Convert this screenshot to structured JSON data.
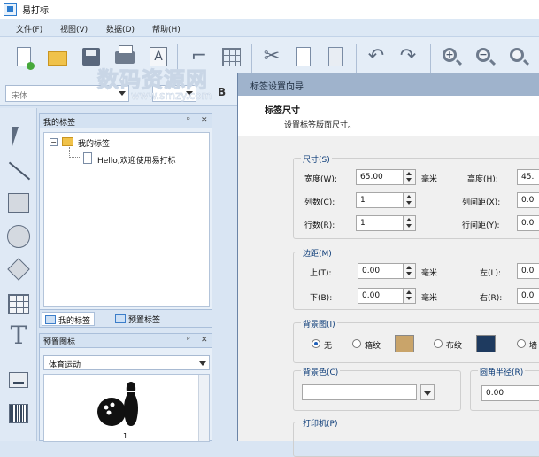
{
  "app": {
    "title": "易打标"
  },
  "menu": [
    "文件(F)",
    "视图(V)",
    "数据(D)",
    "帮助(H)"
  ],
  "watermark": {
    "text": "数码资源网",
    "url": "www.smzy.com"
  },
  "fontbar": {
    "font_name": "宋体"
  },
  "labels_panel": {
    "title": "我的标签",
    "tree_root": "我的标签",
    "tree_item": "Hello,欢迎使用易打标",
    "tabs": [
      "我的标签",
      "预置标签"
    ]
  },
  "preset_panel": {
    "title": "预置图标",
    "category": "体育运动",
    "icon_caption": "1"
  },
  "dialog": {
    "title": "标签设置向导",
    "heading": "标签尺寸",
    "subheading": "设置标签版面尺寸。",
    "size_group": {
      "title": "尺寸(S)",
      "width_label": "宽度(W):",
      "width_value": "65.00",
      "width_unit": "毫米",
      "height_label": "高度(H):",
      "height_value": "45.",
      "cols_label": "列数(C):",
      "cols_value": "1",
      "col_gap_label": "列间距(X):",
      "col_gap_value": "0.0",
      "rows_label": "行数(R):",
      "rows_value": "1",
      "row_gap_label": "行间距(Y):",
      "row_gap_value": "0.0"
    },
    "margin_group": {
      "title": "边距(M)",
      "top_label": "上(T):",
      "top_value": "0.00",
      "top_unit": "毫米",
      "left_label": "左(L):",
      "left_value": "0.0",
      "bottom_label": "下(B):",
      "bottom_value": "0.00",
      "bottom_unit": "毫米",
      "right_label": "右(R):",
      "right_value": "0.0"
    },
    "background_group": {
      "title": "背景图(I)",
      "options": [
        "无",
        "箱纹",
        "布纹",
        "墙"
      ],
      "swatch_colors": [
        "#c9a46a",
        "#1e3a5f"
      ]
    },
    "bgcolor": {
      "label": "背景色(C)",
      "value": ""
    },
    "corner": {
      "label": "圆角半径(R)",
      "value": "0.00"
    },
    "printer": {
      "label": "打印机(P)"
    }
  }
}
